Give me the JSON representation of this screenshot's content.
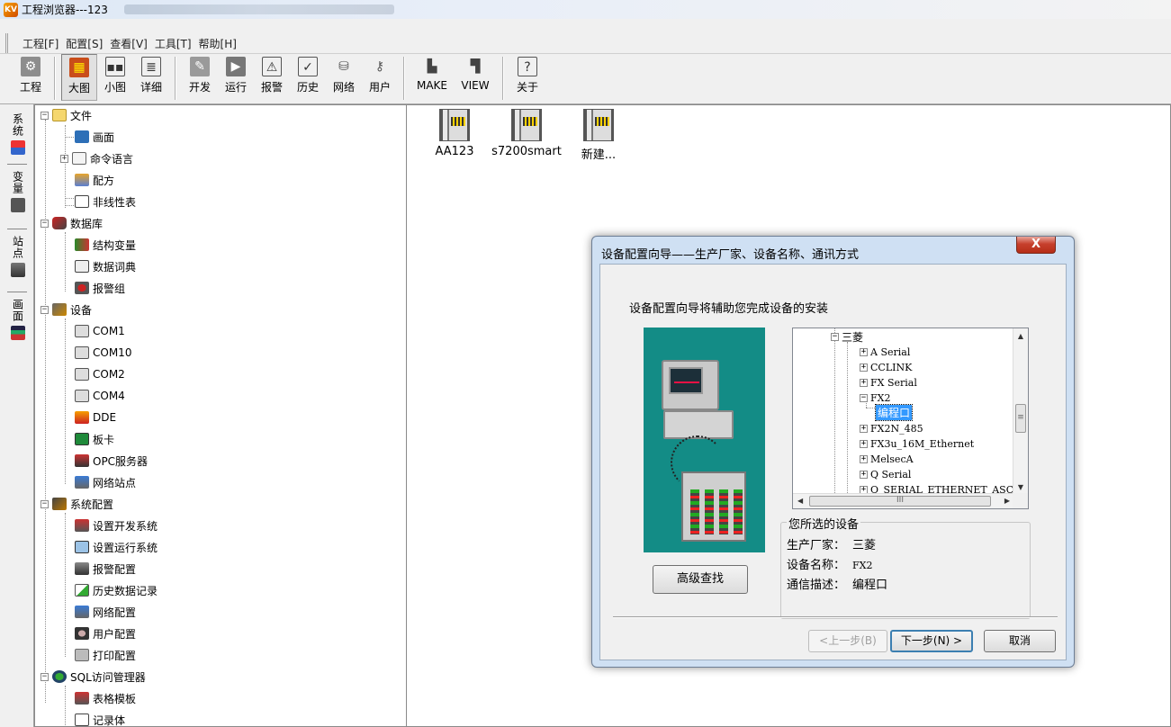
{
  "window": {
    "title": "工程浏览器---123"
  },
  "menu": [
    "工程[F]",
    "配置[S]",
    "查看[V]",
    "工具[T]",
    "帮助[H]"
  ],
  "toolbar": {
    "groups": [
      [
        {
          "label": "工程",
          "icon": "project-icon"
        }
      ],
      [
        {
          "label": "大图",
          "icon": "large-icons-icon",
          "active": true
        },
        {
          "label": "小图",
          "icon": "small-icons-icon"
        },
        {
          "label": "详细",
          "icon": "details-icon"
        }
      ],
      [
        {
          "label": "开发",
          "icon": "develop-icon"
        },
        {
          "label": "运行",
          "icon": "run-icon"
        },
        {
          "label": "报警",
          "icon": "alarm-icon"
        },
        {
          "label": "历史",
          "icon": "history-icon"
        },
        {
          "label": "网络",
          "icon": "network-icon"
        },
        {
          "label": "用户",
          "icon": "user-icon"
        }
      ],
      [
        {
          "label": "MAKE",
          "icon": "make-icon"
        },
        {
          "label": "VIEW",
          "icon": "view-icon"
        }
      ],
      [
        {
          "label": "关于",
          "icon": "about-icon"
        }
      ]
    ]
  },
  "side_tabs": [
    "系统",
    "变量",
    "站点",
    "画面"
  ],
  "tree": {
    "file": "文件",
    "screen": "画面",
    "command_lang": "命令语言",
    "recipe": "配方",
    "nonlinear": "非线性表",
    "database": "数据库",
    "struct_var": "结构变量",
    "data_dict": "数据词典",
    "alarm_group": "报警组",
    "device": "设备",
    "com1": "COM1",
    "com10": "COM10",
    "com2": "COM2",
    "com4": "COM4",
    "dde": "DDE",
    "board": "板卡",
    "opc": "OPC服务器",
    "net_station": "网络站点",
    "sys_config": "系统配置",
    "set_dev": "设置开发系统",
    "set_run": "设置运行系统",
    "alarm_cfg": "报警配置",
    "hist_rec": "历史数据记录",
    "net_cfg": "网络配置",
    "user_cfg": "用户配置",
    "print_cfg": "打印配置",
    "sql": "SQL访问管理器",
    "table_tpl": "表格模板",
    "recordset": "记录体"
  },
  "devices": [
    "AA123",
    "s7200smart",
    "新建..."
  ],
  "dialog": {
    "title": "设备配置向导——生产厂家、设备名称、通讯方式",
    "close": "X",
    "intro": "设备配置向导将辅助您完成设备的安装",
    "tree": {
      "root": "三菱",
      "items": [
        "A Serial",
        "CCLINK",
        "FX Serial",
        "FX2",
        "编程口",
        "FX2N_485",
        "FX3u_16M_Ethernet",
        "MelsecA",
        "Q Serial",
        "Q_SERIAL_ETHERNET_ASCI"
      ],
      "selected": "编程口"
    },
    "adv_search": "高级查找",
    "selected_group": {
      "title": "您所选的设备",
      "manufacturer_label": "生产厂家：",
      "manufacturer": "三菱",
      "device_label": "设备名称：",
      "device": "FX2",
      "comm_label": "通信描述：",
      "comm": "编程口"
    },
    "buttons": {
      "prev": "<上一步(B)",
      "next": "下一步(N) >",
      "cancel": "取消"
    }
  },
  "colors": {
    "illustration_bg": "#138c86",
    "selection": "#3399ff",
    "close": "#c7402d"
  }
}
